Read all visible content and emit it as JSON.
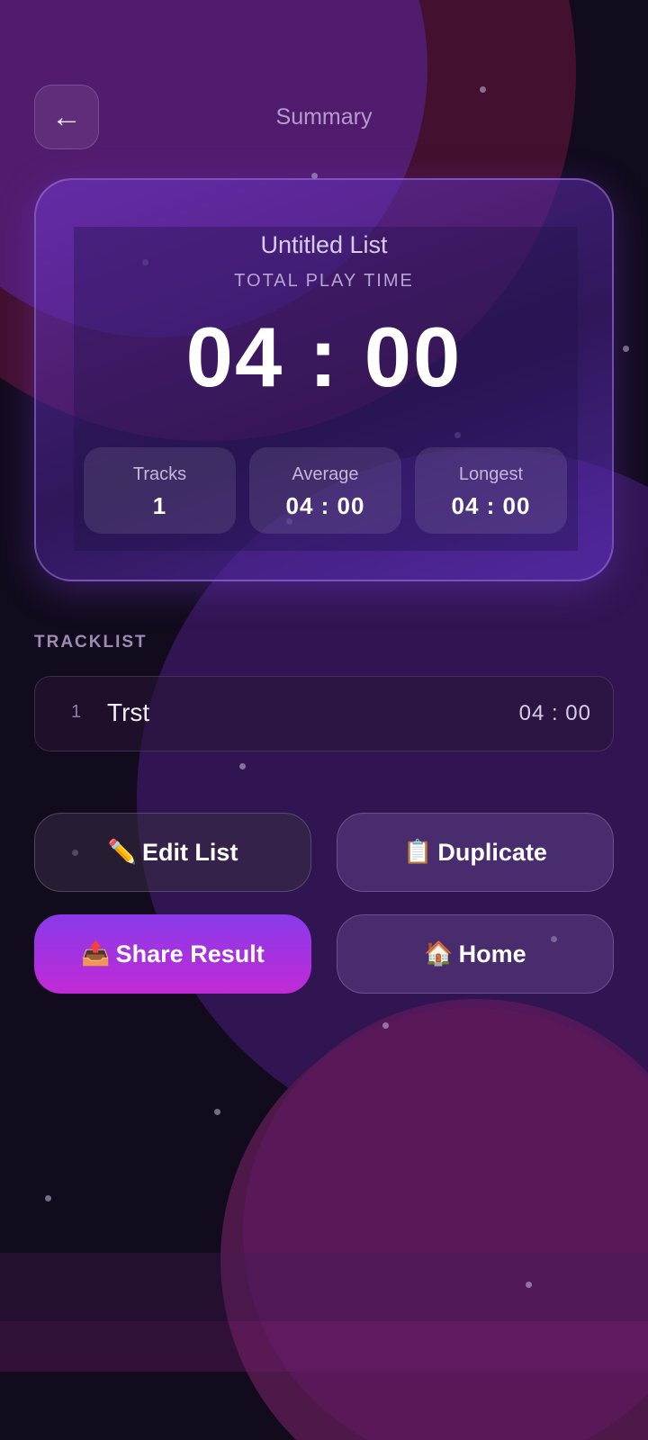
{
  "header": {
    "back_icon": "←",
    "title": "Summary"
  },
  "summary_card": {
    "list_name": "Untitled List",
    "total_label": "TOTAL PLAY TIME",
    "total_time": "04 : 00",
    "stats": [
      {
        "label": "Tracks",
        "value": "1"
      },
      {
        "label": "Average",
        "value": "04 : 00"
      },
      {
        "label": "Longest",
        "value": "04 : 00"
      }
    ]
  },
  "tracklist": {
    "label": "TRACKLIST",
    "tracks": [
      {
        "number": "1",
        "title": "Trst",
        "duration": "04 : 00"
      }
    ]
  },
  "actions": {
    "edit": {
      "icon": "✏️",
      "label": "Edit List"
    },
    "duplicate": {
      "icon": "📋",
      "label": "Duplicate"
    },
    "share": {
      "icon": "📤",
      "label": "Share Result"
    },
    "home": {
      "icon": "🏠",
      "label": "Home"
    }
  },
  "colors": {
    "background": "#120b1d",
    "card_accent": "#6f34c4",
    "share_gradient_start": "#8a3ae8",
    "share_gradient_end": "#c22ad6"
  }
}
